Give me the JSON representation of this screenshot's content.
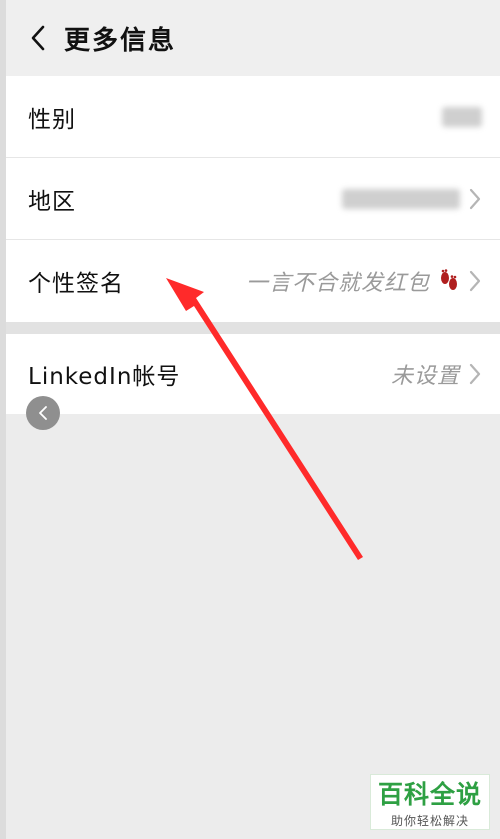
{
  "header": {
    "title": "更多信息",
    "back_icon": "chevron-left-icon"
  },
  "section1": {
    "rows": [
      {
        "label": "性别",
        "value": "",
        "value_blurred": true
      },
      {
        "label": "地区",
        "value": "",
        "value_blurred": true
      },
      {
        "label": "个性签名",
        "value": "一言不合就发红包",
        "value_icon": "footprints-icon"
      }
    ]
  },
  "section2": {
    "rows": [
      {
        "label": "LinkedIn帐号",
        "value": "未设置"
      }
    ]
  },
  "floating_button": {
    "icon": "chevron-left-icon"
  },
  "annotation": {
    "color": "#ff2a2a",
    "icon": "red-arrow"
  },
  "watermark": {
    "main": "百科全说",
    "sub": "助你轻松解决",
    "color": "#2ea043"
  }
}
